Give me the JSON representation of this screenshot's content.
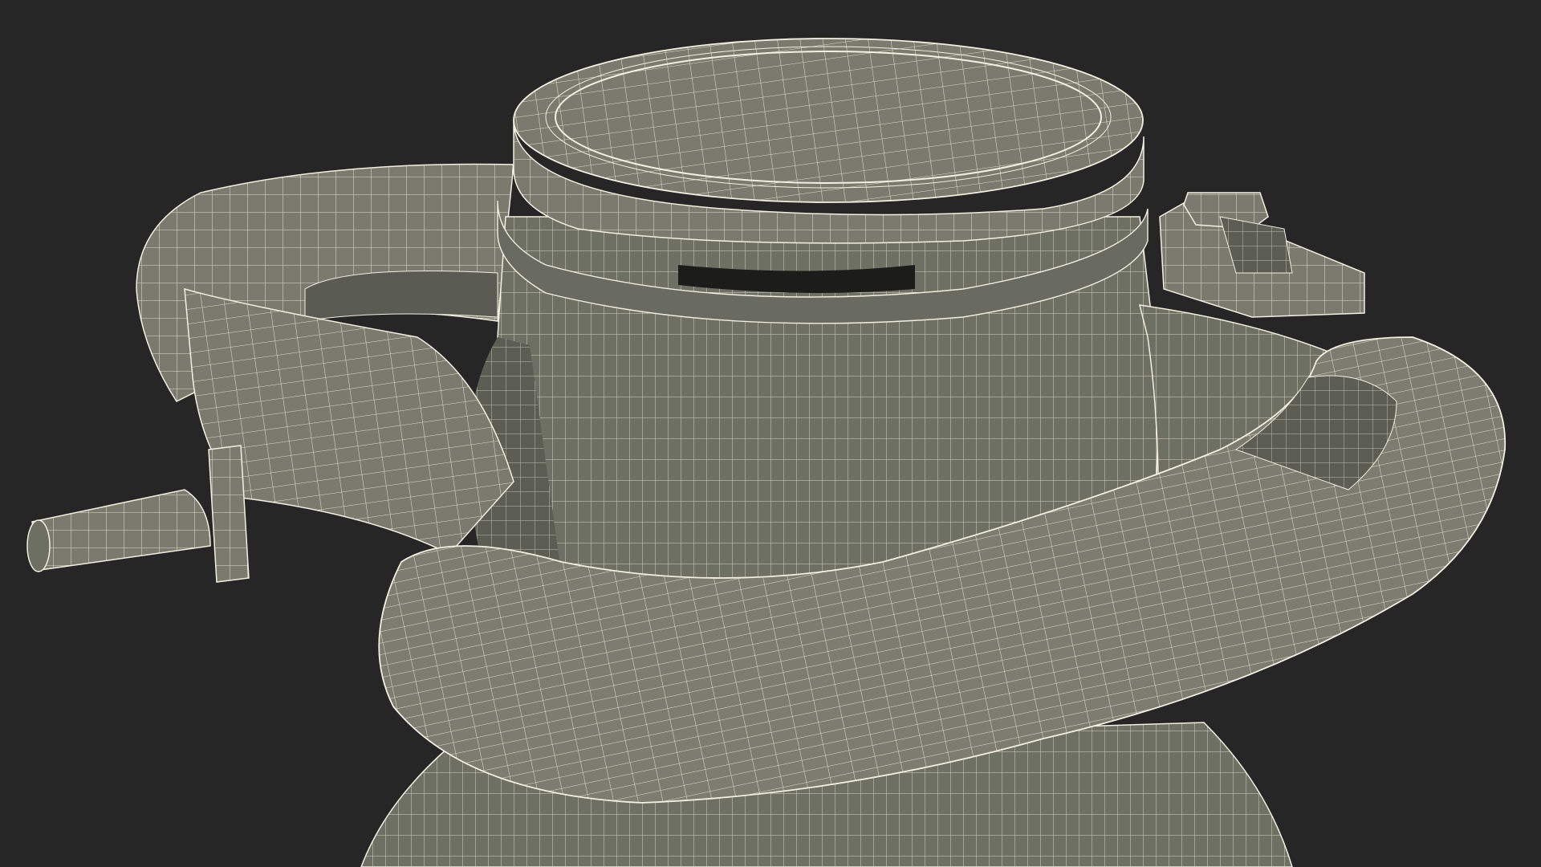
{
  "scene": {
    "subject": "wireframe-render",
    "background_color": "#262626",
    "surface_color": "#7a7b6e",
    "surface_dark_color": "#5c5d53",
    "shadow_color": "#1c1c1a",
    "wire_color": "#f2f0e0",
    "icons": [
      "sprayer-pump-mesh-icon"
    ]
  }
}
